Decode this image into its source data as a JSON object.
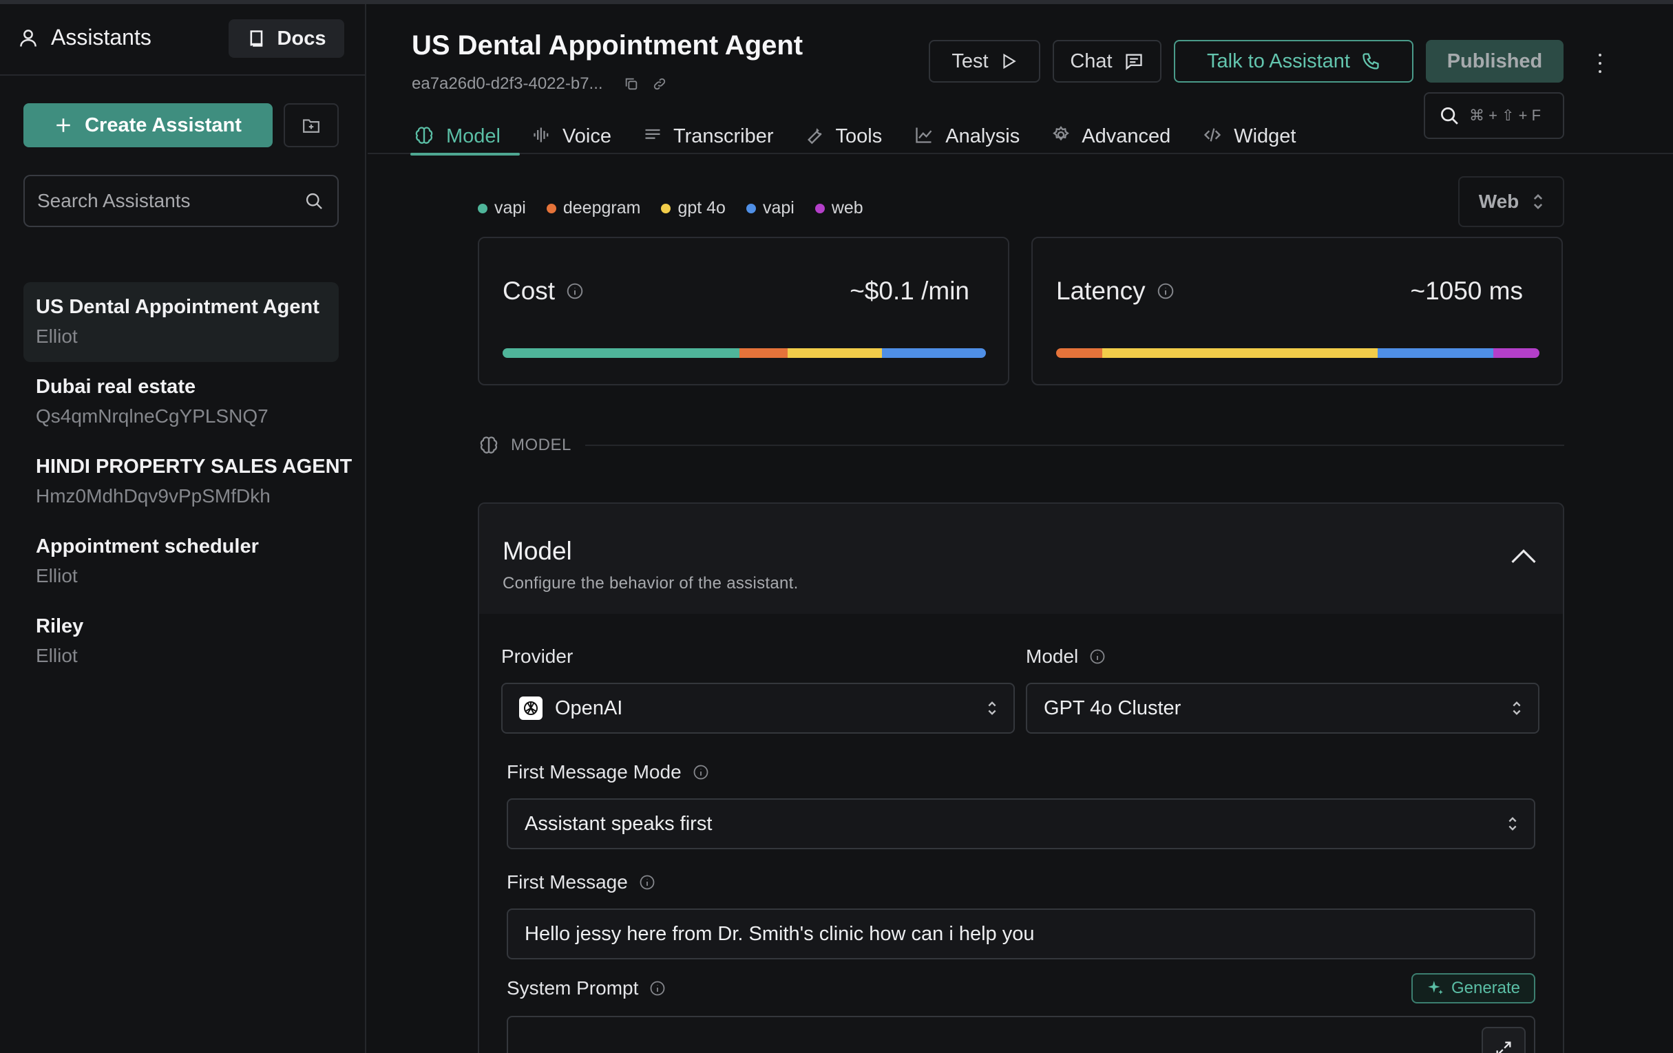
{
  "sidebar": {
    "title": "Assistants",
    "docs_label": "Docs",
    "create_label": "Create Assistant",
    "search_placeholder": "Search Assistants",
    "assistants": [
      {
        "name": "US Dental Appointment Agent",
        "sub": "Elliot",
        "active": true
      },
      {
        "name": "Dubai real estate",
        "sub": "Qs4qmNrqlneCgYPLSNQ7"
      },
      {
        "name": "HINDI PROPERTY SALES AGENT",
        "sub": "Hmz0MdhDqv9vPpSMfDkh"
      },
      {
        "name": "Appointment scheduler",
        "sub": "Elliot"
      },
      {
        "name": "Riley",
        "sub": "Elliot"
      }
    ]
  },
  "header": {
    "title": "US Dental Appointment Agent",
    "assistant_id": "ea7a26d0-d2f3-4022-b7...",
    "test_label": "Test",
    "chat_label": "Chat",
    "talk_label": "Talk to Assistant",
    "published_label": "Published",
    "shortcut": "⌘ + ⇧ + F",
    "tabs": [
      {
        "label": "Model",
        "active": true
      },
      {
        "label": "Voice"
      },
      {
        "label": "Transcriber"
      },
      {
        "label": "Tools"
      },
      {
        "label": "Analysis"
      },
      {
        "label": "Advanced"
      },
      {
        "label": "Widget"
      }
    ]
  },
  "legend": [
    {
      "label": "vapi",
      "color": "#4fb59a"
    },
    {
      "label": "deepgram",
      "color": "#e5733a"
    },
    {
      "label": "gpt 4o",
      "color": "#f2cd4a"
    },
    {
      "label": "vapi",
      "color": "#4f8fe6"
    },
    {
      "label": "web",
      "color": "#b43fc9"
    }
  ],
  "platform_select": "Web",
  "cost": {
    "label": "Cost",
    "value": "~$0.1 /min",
    "segments": [
      {
        "color": "#4fb59a",
        "fraction": 0.49
      },
      {
        "color": "#e5733a",
        "fraction": 0.1
      },
      {
        "color": "#f2cd4a",
        "fraction": 0.195
      },
      {
        "color": "#4f8fe6",
        "fraction": 0.215
      }
    ]
  },
  "latency": {
    "label": "Latency",
    "value": "~1050 ms",
    "segments": [
      {
        "color": "#e5733a",
        "fraction": 0.095
      },
      {
        "color": "#f2cd4a",
        "fraction": 0.57
      },
      {
        "color": "#4f8fe6",
        "fraction": 0.24
      },
      {
        "color": "#b43fc9",
        "fraction": 0.095
      }
    ]
  },
  "section_label": "MODEL",
  "model_card": {
    "title": "Model",
    "description": "Configure the behavior of the assistant.",
    "provider_label": "Provider",
    "provider_value": "OpenAI",
    "model_label": "Model",
    "model_value": "GPT 4o Cluster",
    "first_mode_label": "First Message Mode",
    "first_mode_value": "Assistant speaks first",
    "first_message_label": "First Message",
    "first_message_value": "Hello jessy here from Dr. Smith's clinic how can i help you",
    "system_prompt_label": "System Prompt",
    "generate_label": "Generate"
  },
  "colors": {
    "accent": "#4ea792",
    "background": "#111214"
  }
}
